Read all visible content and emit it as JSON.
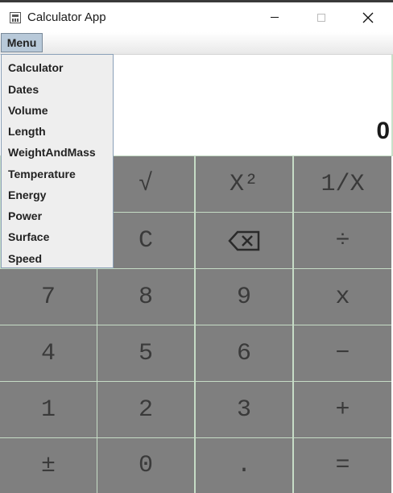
{
  "window": {
    "title": "Calculator App",
    "minimize_label": "",
    "close_label": "✕"
  },
  "menubar": {
    "menu_label": "Menu"
  },
  "dropdown": {
    "items": [
      "Calculator",
      "Dates",
      "Volume",
      "Length",
      "WeightAndMass",
      "Temperature",
      "Energy",
      "Power",
      "Surface",
      "Speed"
    ]
  },
  "display": {
    "value": "0"
  },
  "keys": {
    "sqrt": "√",
    "square": "X²",
    "reciprocal": "1/X",
    "clear": "C",
    "backspace": "⌫",
    "divide": "÷",
    "seven": "7",
    "eight": "8",
    "nine": "9",
    "multiply": "x",
    "four": "4",
    "five": "5",
    "six": "6",
    "minus": "−",
    "one": "1",
    "two": "2",
    "three": "3",
    "plus": "+",
    "plus_minus": "±",
    "zero": "0",
    "decimal": ".",
    "equals": "="
  },
  "colors": {
    "key_background": "#7f7f7f",
    "key_text": "#3a3a3a",
    "grid_lines": "#c6dcc6",
    "menu_highlight": "#b8c9d9"
  }
}
